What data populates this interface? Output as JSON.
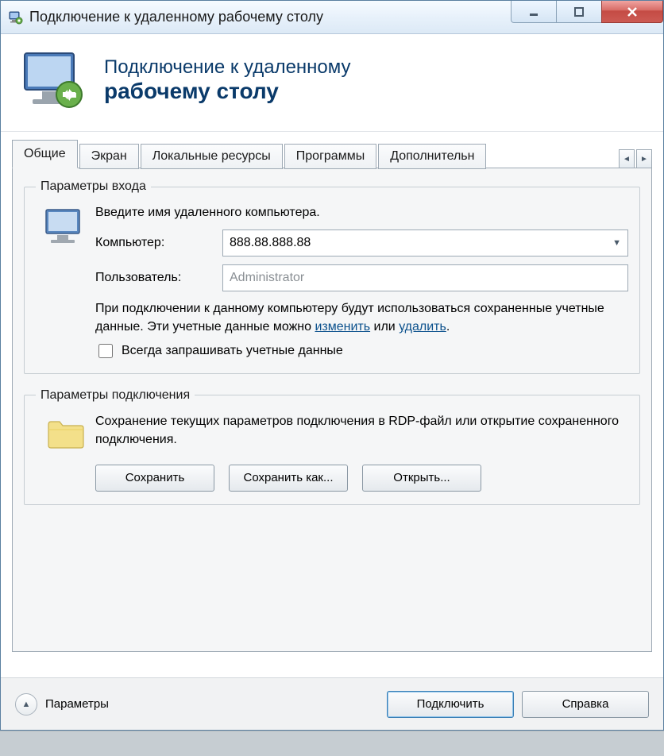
{
  "window": {
    "title": "Подключение к удаленному рабочему столу"
  },
  "banner": {
    "line1": "Подключение к удаленному",
    "line2": "рабочему столу"
  },
  "tabs": {
    "items": [
      {
        "label": "Общие",
        "active": true
      },
      {
        "label": "Экран",
        "active": false
      },
      {
        "label": "Локальные ресурсы",
        "active": false
      },
      {
        "label": "Программы",
        "active": false
      },
      {
        "label": "Дополнительн",
        "active": false
      }
    ]
  },
  "login_group": {
    "legend": "Параметры входа",
    "instruction": "Введите имя удаленного компьютера.",
    "computer_label": "Компьютер:",
    "computer_value": "888.88.888.88",
    "user_label": "Пользователь:",
    "user_value": "Administrator",
    "saved_creds_prefix": "При подключении к данному компьютеру будут использоваться сохраненные учетные данные. Эти учетные данные можно ",
    "link_change": "изменить",
    "or": " или ",
    "link_delete": "удалить",
    "period": ".",
    "always_ask_label": "Всегда запрашивать учетные данные"
  },
  "conn_group": {
    "legend": "Параметры подключения",
    "description": "Сохранение текущих параметров подключения в RDP-файл или открытие сохраненного подключения.",
    "save_label": "Сохранить",
    "save_as_label": "Сохранить как...",
    "open_label": "Открыть..."
  },
  "bottom": {
    "params_label": "Параметры",
    "connect_label": "Подключить",
    "help_label": "Справка"
  }
}
